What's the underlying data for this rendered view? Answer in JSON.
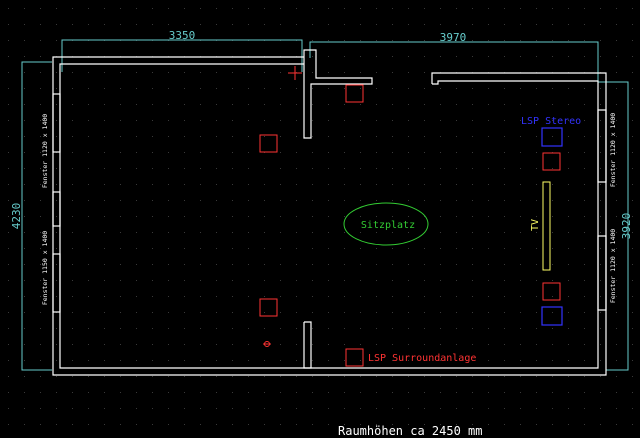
{
  "drawing": {
    "background": "#000000",
    "grid_color": "#3a3a3a",
    "colors": {
      "walls": "#ffffff",
      "dimensions": "#66cccc",
      "surround": "#ff3333",
      "stereo": "#3333ff",
      "tv": "#ffff66",
      "seat": "#33cc33",
      "crosshair": "#ff3333"
    },
    "dimensions": {
      "top_left": "3350",
      "top_right": "3970",
      "left": "4230",
      "right": "3920"
    },
    "windows": {
      "left_top": "Fenster 1120 x 1400",
      "left_mid": "Fenster 1150 x 1400",
      "left_bottom": "Fenster 1120 x 1400",
      "right_top": "Fenster 1120 x 1400",
      "right_bottom": "Fenster 1120 x 1400"
    },
    "labels": {
      "stereo": "LSP Stereo",
      "surround": "LSP Surroundanlage",
      "seat": "Sitzplatz",
      "tv": "TV",
      "footer": "Raumhöhen ca 2450 mm"
    },
    "icons": [
      "crosshair-icon",
      "marker-icon"
    ]
  }
}
